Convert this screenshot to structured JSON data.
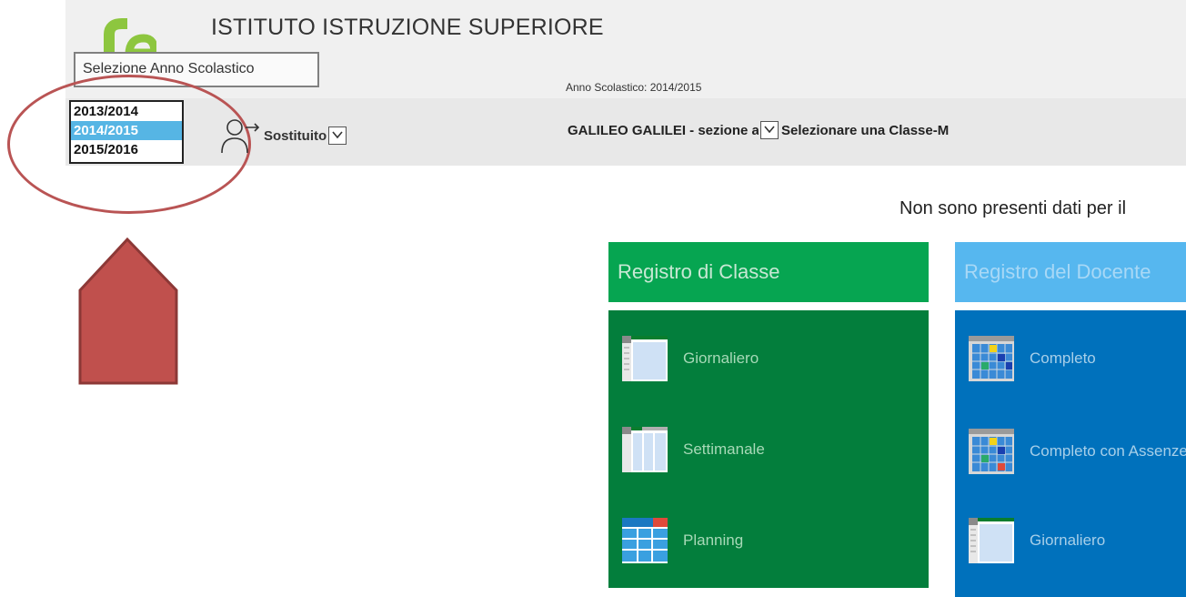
{
  "header": {
    "school_name": "ISTITUTO ISTRUZIONE SUPERIORE",
    "school_year_label": "Anno Scolastico: 2014/2015"
  },
  "year_selector": {
    "tooltip": "Selezione Anno Scolastico",
    "options": [
      "2013/2014",
      "2014/2015",
      "2015/2016"
    ],
    "selected": "2014/2015"
  },
  "toolbar": {
    "substitute_label": "Sostituito",
    "school_select": "GALILEO GALILEI - sezione associata IPIA R. LUXEMBURG",
    "class_select": "Selezionare una Classe-M"
  },
  "message": "Non sono presenti dati per il",
  "tiles": {
    "registro_classe": {
      "title": "Registro di Classe",
      "items": [
        "Giornaliero",
        "Settimanale",
        "Planning"
      ]
    },
    "registro_docente": {
      "title": "Registro del Docente",
      "items": [
        "Completo",
        "Completo con Assenze",
        "Giornaliero"
      ]
    }
  },
  "colors": {
    "green_header": "#06a551",
    "green_body": "#037e3c",
    "blue_header": "#56b7ef",
    "blue_body": "#0071bc",
    "annotation": "#c0504d"
  }
}
